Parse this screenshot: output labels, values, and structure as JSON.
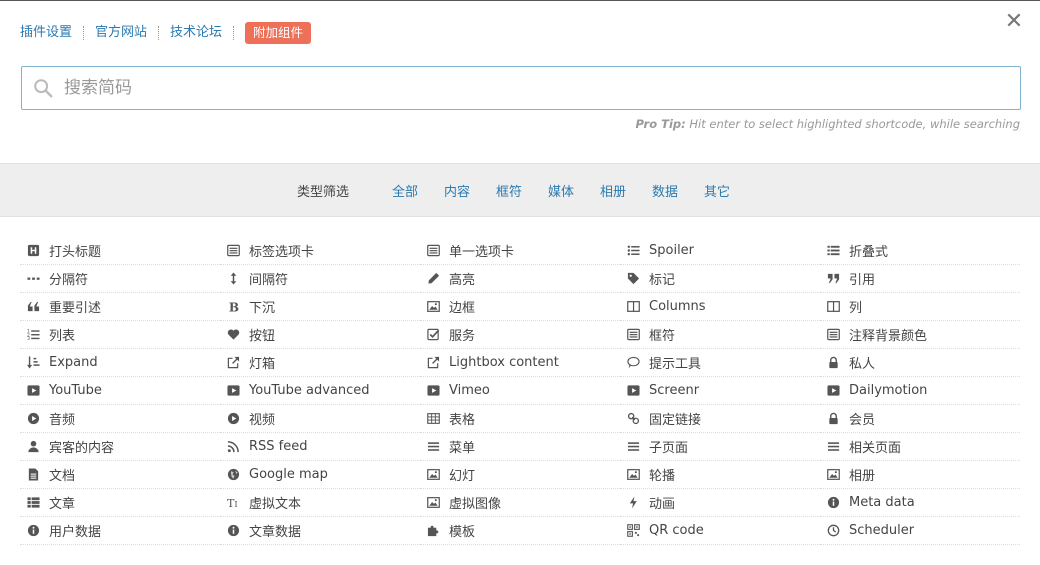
{
  "top_links": {
    "settings": "插件设置",
    "website": "官方网站",
    "forum": "技术论坛",
    "addons": "附加组件"
  },
  "close_label": "✕",
  "search": {
    "placeholder": "搜索简码"
  },
  "protip": {
    "label": "Pro Tip:",
    "text": " Hit enter to select highlighted shortcode, while searching"
  },
  "filter": {
    "label": "类型筛选",
    "items": [
      "全部",
      "内容",
      "框符",
      "媒体",
      "相册",
      "数据",
      "其它"
    ]
  },
  "colors": {
    "link": "#2a7ab0",
    "addon_bg": "#ee7058",
    "filter_bg": "#eeeeee",
    "search_border": "#7fb3d0"
  },
  "shortcodes": [
    {
      "label": "打头标题",
      "icon": "heading-icon"
    },
    {
      "label": "标签选项卡",
      "icon": "list-alt-icon"
    },
    {
      "label": "单一选项卡",
      "icon": "list-alt-icon"
    },
    {
      "label": "Spoiler",
      "icon": "list-ul-icon"
    },
    {
      "label": "折叠式",
      "icon": "list-icon"
    },
    {
      "label": "分隔符",
      "icon": "ellipsis-icon"
    },
    {
      "label": "间隔符",
      "icon": "arrows-v-icon"
    },
    {
      "label": "高亮",
      "icon": "pencil-icon"
    },
    {
      "label": "标记",
      "icon": "tag-icon"
    },
    {
      "label": "引用",
      "icon": "quote-right-icon"
    },
    {
      "label": "重要引述",
      "icon": "quote-left-icon"
    },
    {
      "label": "下沉",
      "icon": "bold-icon"
    },
    {
      "label": "边框",
      "icon": "picture-icon"
    },
    {
      "label": "Columns",
      "icon": "columns-icon"
    },
    {
      "label": "列",
      "icon": "columns-icon"
    },
    {
      "label": "列表",
      "icon": "list-ol-icon"
    },
    {
      "label": "按钮",
      "icon": "heart-icon"
    },
    {
      "label": "服务",
      "icon": "check-square-icon"
    },
    {
      "label": "框符",
      "icon": "list-alt-icon"
    },
    {
      "label": "注释背景颜色",
      "icon": "list-alt-icon"
    },
    {
      "label": "Expand",
      "icon": "sort-amount-icon"
    },
    {
      "label": "灯箱",
      "icon": "external-link-icon"
    },
    {
      "label": "Lightbox content",
      "icon": "external-link-icon"
    },
    {
      "label": "提示工具",
      "icon": "comment-icon"
    },
    {
      "label": "私人",
      "icon": "lock-icon"
    },
    {
      "label": "YouTube",
      "icon": "play-square-icon"
    },
    {
      "label": "YouTube advanced",
      "icon": "play-square-icon"
    },
    {
      "label": "Vimeo",
      "icon": "play-square-icon"
    },
    {
      "label": "Screenr",
      "icon": "play-square-icon"
    },
    {
      "label": "Dailymotion",
      "icon": "play-square-icon"
    },
    {
      "label": "音频",
      "icon": "play-circle-icon"
    },
    {
      "label": "视频",
      "icon": "play-circle-icon"
    },
    {
      "label": "表格",
      "icon": "table-icon"
    },
    {
      "label": "固定链接",
      "icon": "link-icon"
    },
    {
      "label": "会员",
      "icon": "lock-icon"
    },
    {
      "label": "宾客的内容",
      "icon": "user-icon"
    },
    {
      "label": "RSS feed",
      "icon": "rss-icon"
    },
    {
      "label": "菜单",
      "icon": "bars-icon"
    },
    {
      "label": "子页面",
      "icon": "bars-icon"
    },
    {
      "label": "相关页面",
      "icon": "bars-icon"
    },
    {
      "label": "文档",
      "icon": "file-icon"
    },
    {
      "label": "Google map",
      "icon": "globe-icon"
    },
    {
      "label": "幻灯",
      "icon": "picture-icon"
    },
    {
      "label": "轮播",
      "icon": "picture-icon"
    },
    {
      "label": "相册",
      "icon": "picture-icon"
    },
    {
      "label": "文章",
      "icon": "th-list-icon"
    },
    {
      "label": "虚拟文本",
      "icon": "text-height-icon"
    },
    {
      "label": "虚拟图像",
      "icon": "picture-icon"
    },
    {
      "label": "动画",
      "icon": "bolt-icon"
    },
    {
      "label": "Meta data",
      "icon": "info-circle-icon"
    },
    {
      "label": "用户数据",
      "icon": "info-circle-icon"
    },
    {
      "label": "文章数据",
      "icon": "info-circle-icon"
    },
    {
      "label": "模板",
      "icon": "puzzle-icon"
    },
    {
      "label": "QR code",
      "icon": "qrcode-icon"
    },
    {
      "label": "Scheduler",
      "icon": "clock-icon"
    }
  ]
}
